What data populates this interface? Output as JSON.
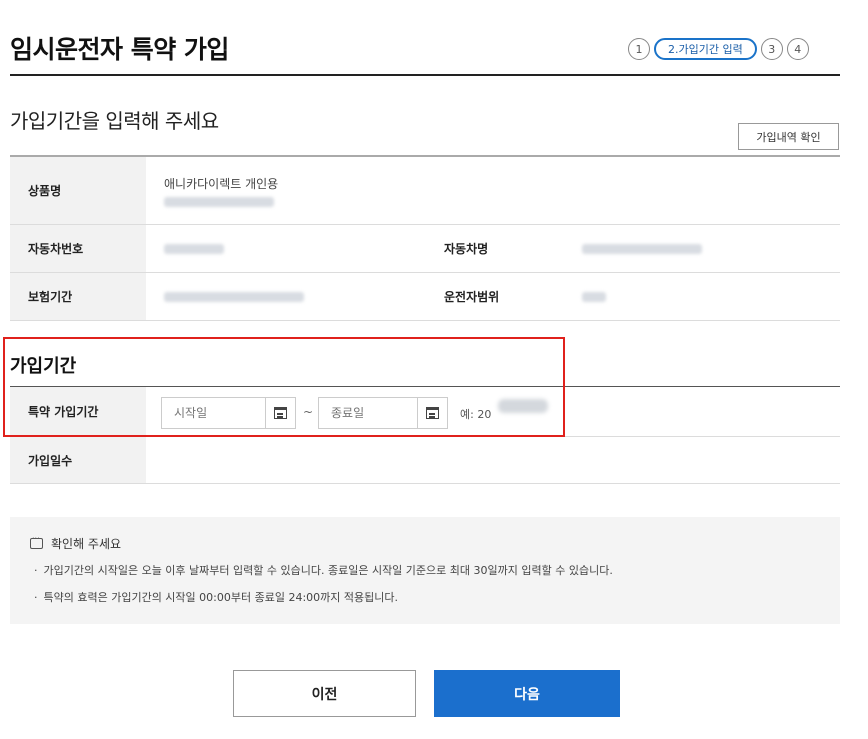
{
  "header": {
    "title": "임시운전자 특약 가입",
    "steps": [
      "1",
      "2.가입기간 입력",
      "3",
      "4"
    ]
  },
  "subtitle": "가입기간을 입력해 주세요",
  "history_button": "가입내역 확인",
  "info_table": {
    "product_label": "상품명",
    "product_value": "애니카다이렉트 개인용",
    "car_number_label": "자동차번호",
    "car_name_label": "자동차명",
    "insurance_period_label": "보험기간",
    "driver_range_label": "운전자범위"
  },
  "join_section": {
    "title": "가입기간",
    "period_label": "특약 가입기간",
    "start_placeholder": "시작일",
    "end_placeholder": "종료일",
    "tilde": "~",
    "example_prefix": "예: 20",
    "days_label": "가입일수"
  },
  "notice": {
    "title": "확인해 주세요",
    "items": [
      "가입기간의 시작일은 오늘 이후 날짜부터 입력할 수 있습니다. 종료일은 시작일 기준으로 최대 30일까지 입력할 수 있습니다.",
      "특약의 효력은 가입기간의 시작일 00:00부터 종료일 24:00까지 적용됩니다."
    ]
  },
  "buttons": {
    "prev": "이전",
    "next": "다음"
  },
  "colors": {
    "primary": "#1b6fcd",
    "highlight_border": "#e0211c",
    "notice_bg": "#f4f4f4"
  }
}
